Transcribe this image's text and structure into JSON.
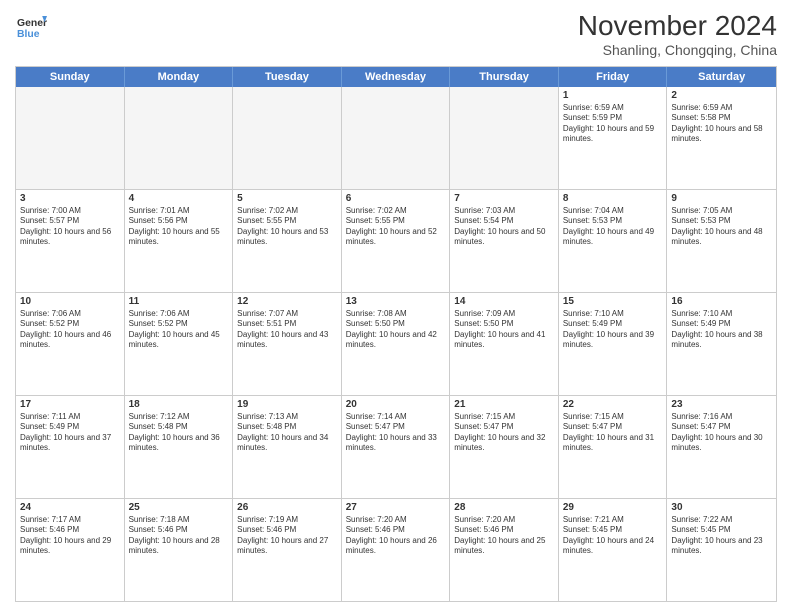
{
  "logo": {
    "line1": "General",
    "line2": "Blue"
  },
  "title": "November 2024",
  "subtitle": "Shanling, Chongqing, China",
  "header_days": [
    "Sunday",
    "Monday",
    "Tuesday",
    "Wednesday",
    "Thursday",
    "Friday",
    "Saturday"
  ],
  "weeks": [
    [
      {
        "day": "",
        "text": "",
        "empty": true
      },
      {
        "day": "",
        "text": "",
        "empty": true
      },
      {
        "day": "",
        "text": "",
        "empty": true
      },
      {
        "day": "",
        "text": "",
        "empty": true
      },
      {
        "day": "",
        "text": "",
        "empty": true
      },
      {
        "day": "1",
        "text": "Sunrise: 6:59 AM\nSunset: 5:59 PM\nDaylight: 10 hours and 59 minutes.",
        "empty": false
      },
      {
        "day": "2",
        "text": "Sunrise: 6:59 AM\nSunset: 5:58 PM\nDaylight: 10 hours and 58 minutes.",
        "empty": false
      }
    ],
    [
      {
        "day": "3",
        "text": "Sunrise: 7:00 AM\nSunset: 5:57 PM\nDaylight: 10 hours and 56 minutes.",
        "empty": false
      },
      {
        "day": "4",
        "text": "Sunrise: 7:01 AM\nSunset: 5:56 PM\nDaylight: 10 hours and 55 minutes.",
        "empty": false
      },
      {
        "day": "5",
        "text": "Sunrise: 7:02 AM\nSunset: 5:55 PM\nDaylight: 10 hours and 53 minutes.",
        "empty": false
      },
      {
        "day": "6",
        "text": "Sunrise: 7:02 AM\nSunset: 5:55 PM\nDaylight: 10 hours and 52 minutes.",
        "empty": false
      },
      {
        "day": "7",
        "text": "Sunrise: 7:03 AM\nSunset: 5:54 PM\nDaylight: 10 hours and 50 minutes.",
        "empty": false
      },
      {
        "day": "8",
        "text": "Sunrise: 7:04 AM\nSunset: 5:53 PM\nDaylight: 10 hours and 49 minutes.",
        "empty": false
      },
      {
        "day": "9",
        "text": "Sunrise: 7:05 AM\nSunset: 5:53 PM\nDaylight: 10 hours and 48 minutes.",
        "empty": false
      }
    ],
    [
      {
        "day": "10",
        "text": "Sunrise: 7:06 AM\nSunset: 5:52 PM\nDaylight: 10 hours and 46 minutes.",
        "empty": false
      },
      {
        "day": "11",
        "text": "Sunrise: 7:06 AM\nSunset: 5:52 PM\nDaylight: 10 hours and 45 minutes.",
        "empty": false
      },
      {
        "day": "12",
        "text": "Sunrise: 7:07 AM\nSunset: 5:51 PM\nDaylight: 10 hours and 43 minutes.",
        "empty": false
      },
      {
        "day": "13",
        "text": "Sunrise: 7:08 AM\nSunset: 5:50 PM\nDaylight: 10 hours and 42 minutes.",
        "empty": false
      },
      {
        "day": "14",
        "text": "Sunrise: 7:09 AM\nSunset: 5:50 PM\nDaylight: 10 hours and 41 minutes.",
        "empty": false
      },
      {
        "day": "15",
        "text": "Sunrise: 7:10 AM\nSunset: 5:49 PM\nDaylight: 10 hours and 39 minutes.",
        "empty": false
      },
      {
        "day": "16",
        "text": "Sunrise: 7:10 AM\nSunset: 5:49 PM\nDaylight: 10 hours and 38 minutes.",
        "empty": false
      }
    ],
    [
      {
        "day": "17",
        "text": "Sunrise: 7:11 AM\nSunset: 5:49 PM\nDaylight: 10 hours and 37 minutes.",
        "empty": false
      },
      {
        "day": "18",
        "text": "Sunrise: 7:12 AM\nSunset: 5:48 PM\nDaylight: 10 hours and 36 minutes.",
        "empty": false
      },
      {
        "day": "19",
        "text": "Sunrise: 7:13 AM\nSunset: 5:48 PM\nDaylight: 10 hours and 34 minutes.",
        "empty": false
      },
      {
        "day": "20",
        "text": "Sunrise: 7:14 AM\nSunset: 5:47 PM\nDaylight: 10 hours and 33 minutes.",
        "empty": false
      },
      {
        "day": "21",
        "text": "Sunrise: 7:15 AM\nSunset: 5:47 PM\nDaylight: 10 hours and 32 minutes.",
        "empty": false
      },
      {
        "day": "22",
        "text": "Sunrise: 7:15 AM\nSunset: 5:47 PM\nDaylight: 10 hours and 31 minutes.",
        "empty": false
      },
      {
        "day": "23",
        "text": "Sunrise: 7:16 AM\nSunset: 5:47 PM\nDaylight: 10 hours and 30 minutes.",
        "empty": false
      }
    ],
    [
      {
        "day": "24",
        "text": "Sunrise: 7:17 AM\nSunset: 5:46 PM\nDaylight: 10 hours and 29 minutes.",
        "empty": false
      },
      {
        "day": "25",
        "text": "Sunrise: 7:18 AM\nSunset: 5:46 PM\nDaylight: 10 hours and 28 minutes.",
        "empty": false
      },
      {
        "day": "26",
        "text": "Sunrise: 7:19 AM\nSunset: 5:46 PM\nDaylight: 10 hours and 27 minutes.",
        "empty": false
      },
      {
        "day": "27",
        "text": "Sunrise: 7:20 AM\nSunset: 5:46 PM\nDaylight: 10 hours and 26 minutes.",
        "empty": false
      },
      {
        "day": "28",
        "text": "Sunrise: 7:20 AM\nSunset: 5:46 PM\nDaylight: 10 hours and 25 minutes.",
        "empty": false
      },
      {
        "day": "29",
        "text": "Sunrise: 7:21 AM\nSunset: 5:45 PM\nDaylight: 10 hours and 24 minutes.",
        "empty": false
      },
      {
        "day": "30",
        "text": "Sunrise: 7:22 AM\nSunset: 5:45 PM\nDaylight: 10 hours and 23 minutes.",
        "empty": false
      }
    ]
  ]
}
